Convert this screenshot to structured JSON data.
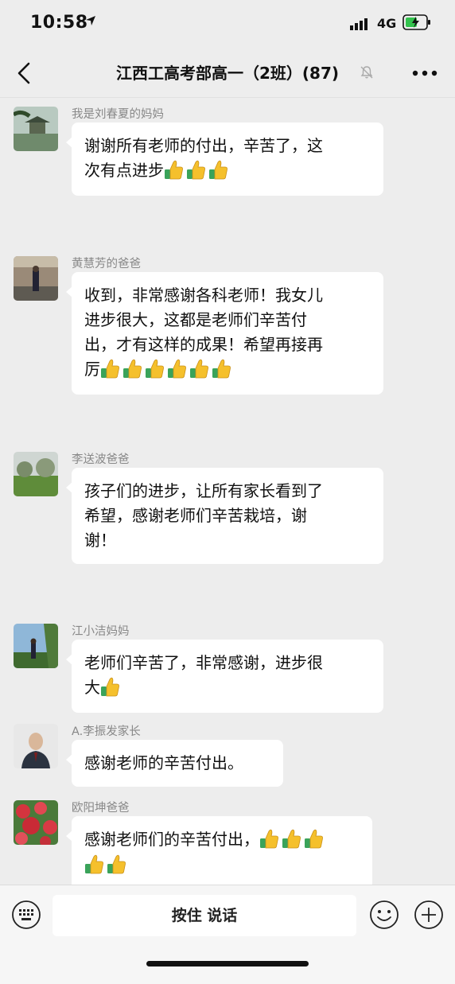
{
  "status": {
    "time": "10:58",
    "network": "4G"
  },
  "header": {
    "title": "江西工高考部高一（2班）(87)",
    "back_icon": "chevron-left-icon",
    "mute_icon": "bell-muted-icon",
    "more_icon": "ellipsis-icon"
  },
  "messages": [
    {
      "sender": "我是刘春夏的妈妈",
      "lines": [
        "谢谢所有老师的付出，辛苦了，这",
        "次有点进步"
      ],
      "thumbs": 3
    },
    {
      "sender": "黄慧芳的爸爸",
      "lines": [
        "收到，非常感谢各科老师！我女儿",
        "进步很大，这都是老师们辛苦付",
        "出，才有这样的成果！希望再接再",
        "厉"
      ],
      "thumbs": 6
    },
    {
      "sender": "李送波爸爸",
      "lines": [
        "孩子们的进步，让所有家长看到了",
        "希望，感谢老师们辛苦栽培，谢",
        "谢！"
      ],
      "thumbs": 0
    },
    {
      "sender": "江小洁妈妈",
      "lines": [
        "老师们辛苦了，非常感谢，进步很",
        "大"
      ],
      "thumbs": 1
    },
    {
      "sender": "A.李振发家长",
      "lines": [
        "感谢老师的辛苦付出。"
      ],
      "thumbs": 0
    },
    {
      "sender": "欧阳坤爸爸",
      "lines": [
        "感谢老师们的辛苦付出，",
        ""
      ],
      "thumbs": 5,
      "thumbs_split": 3
    }
  ],
  "input": {
    "hold_to_talk": "按住 说话",
    "keyboard_icon": "keyboard-icon",
    "emoji_icon": "emoji-icon",
    "plus_icon": "plus-icon"
  },
  "colors": {
    "background": "#ededed",
    "bubble": "#ffffff",
    "sender_text": "#888888",
    "thumb_yellow": "#f5c02c",
    "thumb_cuff": "#3aa35a"
  }
}
